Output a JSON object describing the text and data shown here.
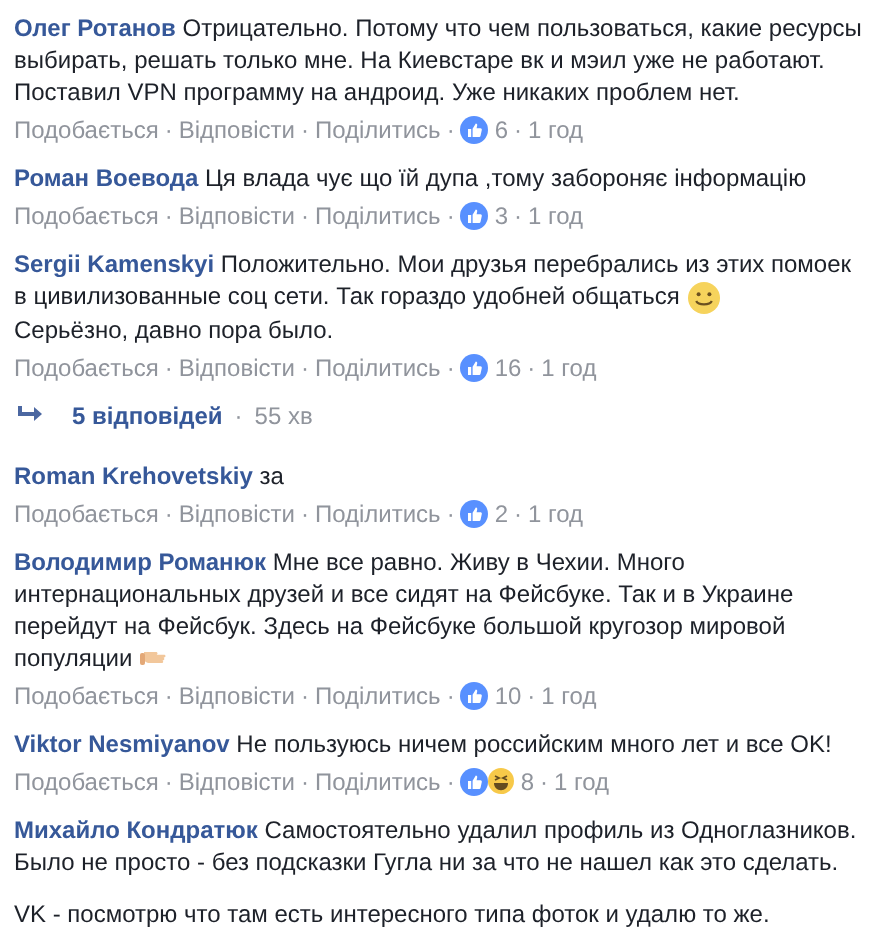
{
  "comments": [
    {
      "author": "Олег Ротанов",
      "lines": [
        "Отрицательно. Потому что чем пользоваться, какие ресурсы",
        "выбирать, решать только мне. На Киевстаре вк и мэил уже не работают.",
        "Поставил VPN программу на андроид. Уже никаких проблем нет."
      ],
      "meta": [
        {
          "kind": "link",
          "text": "Подобається"
        },
        {
          "kind": "dot",
          "text": "·"
        },
        {
          "kind": "link",
          "text": "Відповісти"
        },
        {
          "kind": "dot",
          "text": "·"
        },
        {
          "kind": "link",
          "text": "Поділитись"
        },
        {
          "kind": "dot",
          "text": "·"
        },
        {
          "kind": "like"
        },
        {
          "kind": "count",
          "text": "6"
        },
        {
          "kind": "dot",
          "text": "·"
        },
        {
          "kind": "time",
          "text": "1 год"
        }
      ]
    },
    {
      "author": "Роман Воевода",
      "lines": [
        "Ця влада чує що їй дупа ,тому забороняє інформацію"
      ],
      "meta": [
        {
          "kind": "link",
          "text": "Подобається"
        },
        {
          "kind": "dot",
          "text": "·"
        },
        {
          "kind": "link",
          "text": "Відповісти"
        },
        {
          "kind": "dot",
          "text": "·"
        },
        {
          "kind": "link",
          "text": "Поділитись"
        },
        {
          "kind": "dot",
          "text": "·"
        },
        {
          "kind": "like"
        },
        {
          "kind": "count",
          "text": "3"
        },
        {
          "kind": "dot",
          "text": "·"
        },
        {
          "kind": "time",
          "text": "1 год"
        }
      ]
    },
    {
      "author": "Sergii Kamenskyi",
      "lines": [
        "Положительно. Мои друзья перебрались из этих помоек",
        "в цивилизованные соц сети. Так гораздо удобней общаться"
      ],
      "emoji": {
        "kind": "smile"
      },
      "extra_lines": [
        "Серьёзно, давно пора было."
      ],
      "meta": [
        {
          "kind": "link",
          "text": "Подобається"
        },
        {
          "kind": "dot",
          "text": "·"
        },
        {
          "kind": "link",
          "text": "Відповісти"
        },
        {
          "kind": "dot",
          "text": "·"
        },
        {
          "kind": "link",
          "text": "Поділитись"
        },
        {
          "kind": "dot",
          "text": "·"
        },
        {
          "kind": "like"
        },
        {
          "kind": "count",
          "text": "16"
        },
        {
          "kind": "dot",
          "text": "·"
        },
        {
          "kind": "time",
          "text": "1 год"
        }
      ],
      "replies": {
        "label": "5 відповідей",
        "separator": "·",
        "time": "55 хв"
      }
    },
    {
      "author": "Roman Krehovetskiy",
      "lines": [
        "за"
      ],
      "meta": [
        {
          "kind": "link",
          "text": "Подобається"
        },
        {
          "kind": "dot",
          "text": "·"
        },
        {
          "kind": "link",
          "text": "Відповісти"
        },
        {
          "kind": "dot",
          "text": "·"
        },
        {
          "kind": "link",
          "text": "Поділитись"
        },
        {
          "kind": "dot",
          "text": "·"
        },
        {
          "kind": "like"
        },
        {
          "kind": "count",
          "text": "2"
        },
        {
          "kind": "dot",
          "text": "·"
        },
        {
          "kind": "time",
          "text": "1 год"
        }
      ]
    },
    {
      "author": "Володимир Романюк",
      "lines": [
        "Мне все равно. Живу в Чехии. Много",
        "интернациональных друзей и все сидят на Фейсбуке. Так и в Украине",
        "перейдут на Фейсбук. Здесь на Фейсбуке большой кругозор мировой",
        "популяции"
      ],
      "emoji": {
        "kind": "pointing-hand"
      },
      "meta": [
        {
          "kind": "link",
          "text": "Подобається"
        },
        {
          "kind": "dot",
          "text": "·"
        },
        {
          "kind": "link",
          "text": "Відповісти"
        },
        {
          "kind": "dot",
          "text": "·"
        },
        {
          "kind": "link",
          "text": "Поділитись"
        },
        {
          "kind": "dot",
          "text": "·"
        },
        {
          "kind": "like"
        },
        {
          "kind": "count",
          "text": "10"
        },
        {
          "kind": "dot",
          "text": "·"
        },
        {
          "kind": "time",
          "text": "1 год"
        }
      ]
    },
    {
      "author": "Viktor Nesmiyanov",
      "lines": [
        "Не пользуюсь ничем российским много лет и все OK!"
      ],
      "meta": [
        {
          "kind": "link",
          "text": "Подобається"
        },
        {
          "kind": "dot",
          "text": "·"
        },
        {
          "kind": "link",
          "text": "Відповісти"
        },
        {
          "kind": "dot",
          "text": "·"
        },
        {
          "kind": "link",
          "text": "Поділитись"
        },
        {
          "kind": "dot",
          "text": "·"
        },
        {
          "kind": "like"
        },
        {
          "kind": "haha"
        },
        {
          "kind": "count",
          "text": "8"
        },
        {
          "kind": "dot",
          "text": "·"
        },
        {
          "kind": "time",
          "text": "1 год"
        }
      ]
    },
    {
      "author": "Михайло Кондратюк",
      "lines": [
        "Самостоятельно удалил профиль из Одноглазников.",
        "Было не просто - без подсказки Гугла ни за что не нашел как это сделать."
      ],
      "paragraph": "VK - посмотрю что там есть интересного типа фоток и удалю то же."
    }
  ]
}
